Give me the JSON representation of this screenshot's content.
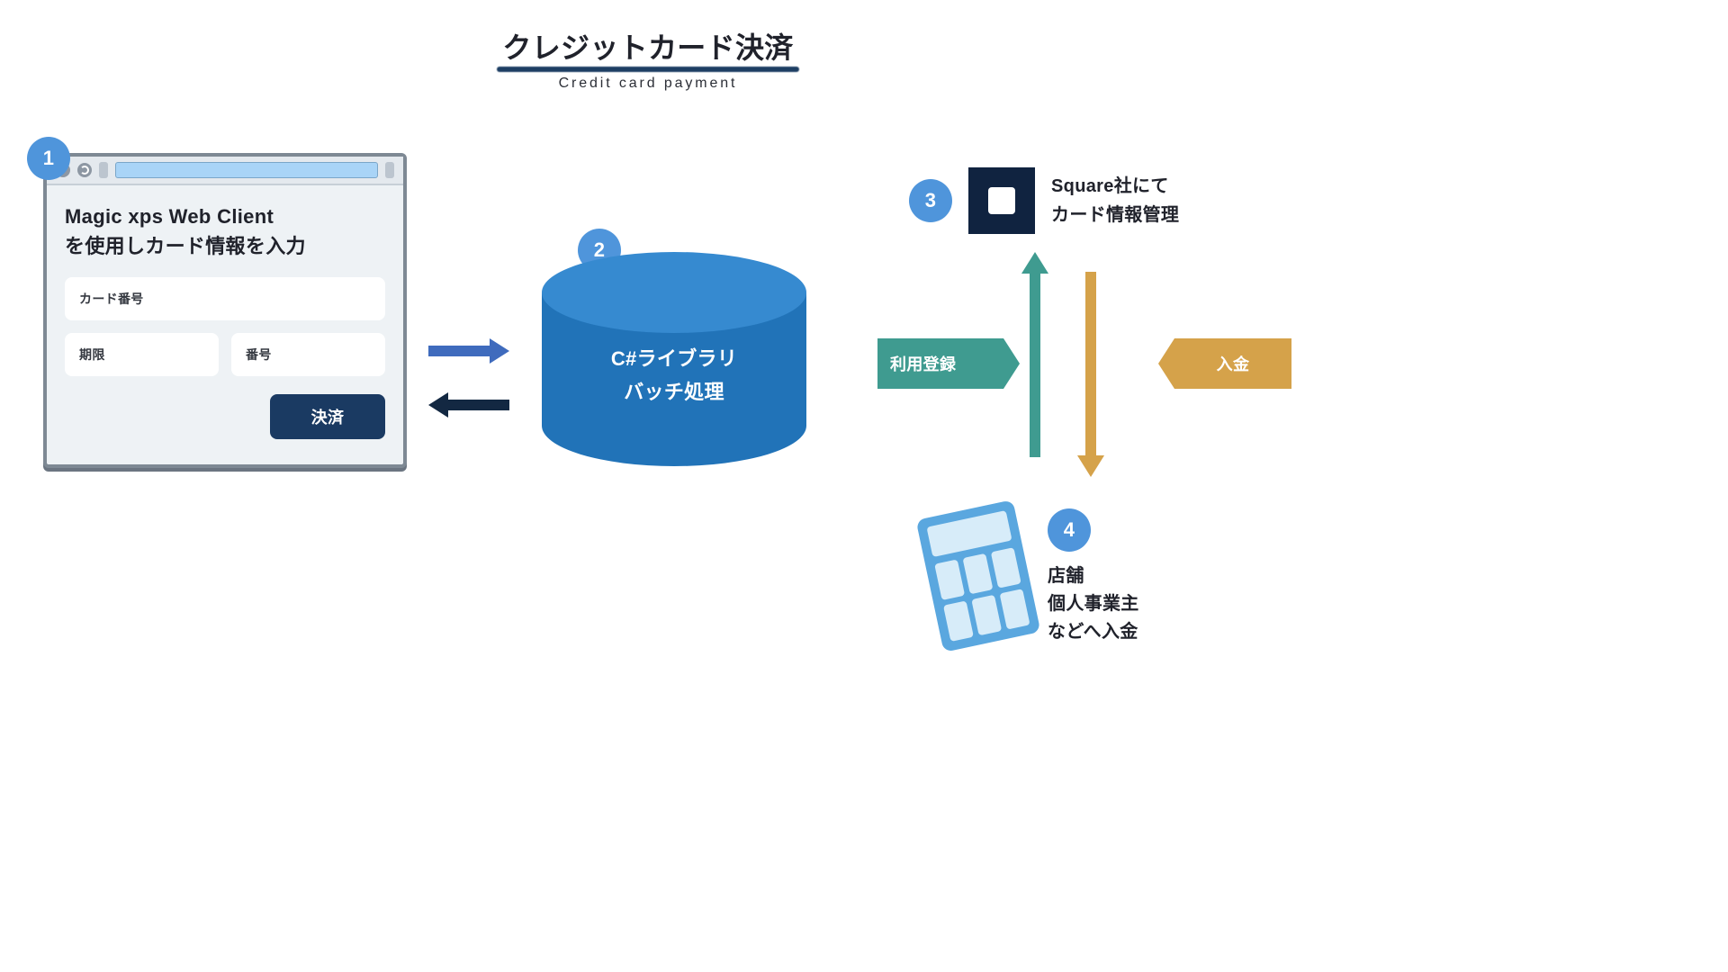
{
  "header": {
    "title_ja": "クレジットカード決済",
    "title_en": "Credit card payment"
  },
  "steps": {
    "s1": {
      "num": "1",
      "panel_title": "Magic xps Web Client\nを使用しカード情報を入力",
      "card_number_label": "カード番号",
      "expiry_label": "期限",
      "cvv_label": "番号",
      "pay_button": "決済"
    },
    "s2": {
      "num": "2",
      "line1": "C#ライブラリ",
      "line2": "バッチ処理"
    },
    "s3": {
      "num": "3",
      "text": "Square社にて\nカード情報管理"
    },
    "s4": {
      "num": "4",
      "text": "店舗\n個人事業主\nなどへ入金"
    }
  },
  "tags": {
    "register": "利用登録",
    "deposit": "入金"
  }
}
